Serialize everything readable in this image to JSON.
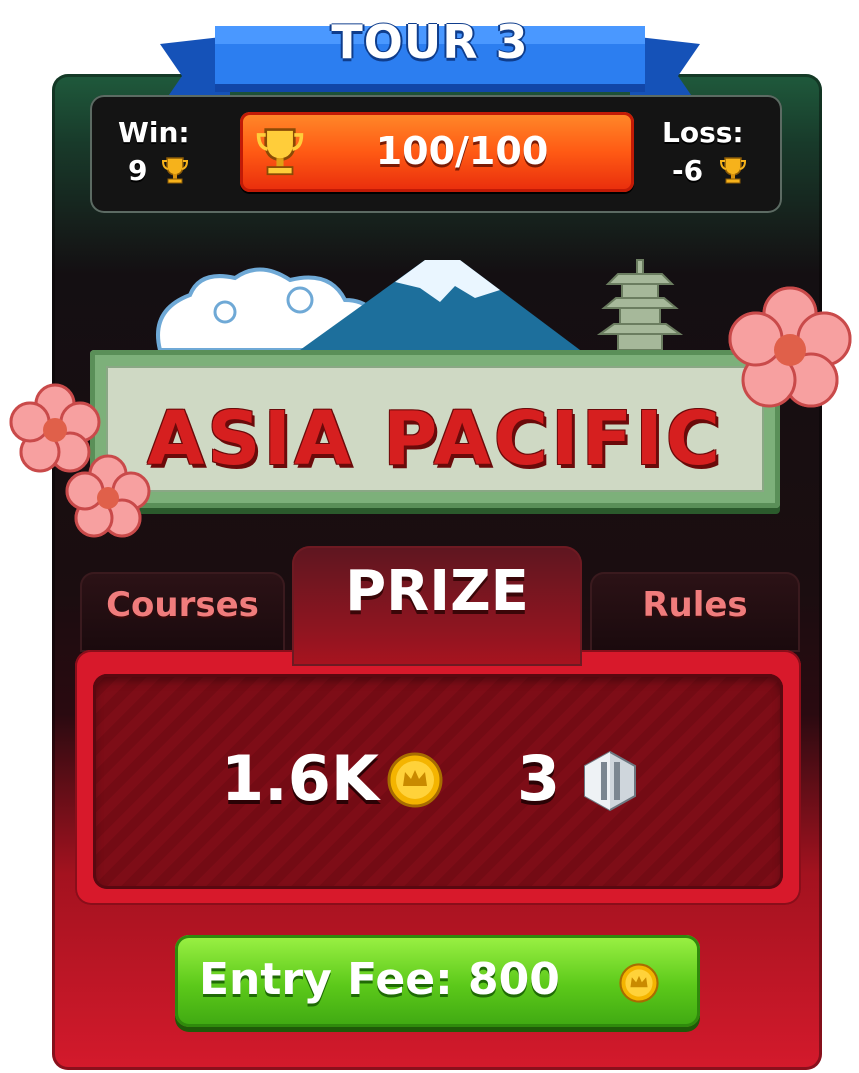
{
  "tour": {
    "title": "TOUR 3"
  },
  "stats": {
    "win_label": "Win:",
    "win_value": "9",
    "progress": "100/100",
    "loss_label": "Loss:",
    "loss_value": "-6"
  },
  "banner": {
    "title": "ASIA PACIFIC"
  },
  "tabs": {
    "courses": "Courses",
    "prize": "PRIZE",
    "rules": "Rules"
  },
  "prize": {
    "coins": "1.6K",
    "gems": "3"
  },
  "entry": {
    "label": "Entry Fee: 800"
  },
  "icons": {
    "trophy": "trophy-icon",
    "coin": "crown-coin-icon",
    "gem": "gem-icon"
  },
  "colors": {
    "ribbon": "#1f6fe0",
    "progress": "#ff5a14",
    "prize_panel": "#d8192b",
    "entry_button": "#5cc91a",
    "courses_tab_text": "#f07c7c"
  }
}
